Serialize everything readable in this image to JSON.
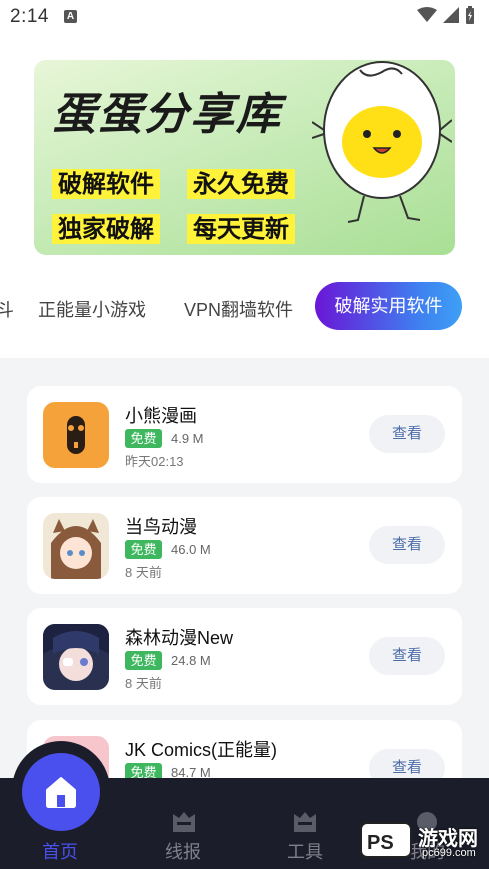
{
  "status_bar": {
    "time": "2:14",
    "notif_letter": "A"
  },
  "banner": {
    "title": "蛋蛋分享库",
    "tags": [
      "破解软件",
      "永久免费",
      "独家破解",
      "每天更新"
    ]
  },
  "tabs": {
    "items": [
      "斗",
      "正能量小游戏",
      "VPN翻墙软件"
    ],
    "active": "破解实用软件"
  },
  "apps": [
    {
      "name": "小熊漫画",
      "badge": "免费",
      "size": "4.9 M",
      "date": "昨天02:13",
      "button": "查看"
    },
    {
      "name": "当鸟动漫",
      "badge": "免费",
      "size": "46.0 M",
      "date": "8 天前",
      "button": "查看"
    },
    {
      "name": "森林动漫New",
      "badge": "免费",
      "size": "24.8 M",
      "date": "8 天前",
      "button": "查看"
    },
    {
      "name": "JK Comics(正能量)",
      "badge": "免费",
      "size": "84.7 M",
      "date": "",
      "button": "查看"
    }
  ],
  "bottom_nav": {
    "items": [
      "首页",
      "线报",
      "工具",
      "我的"
    ],
    "active_index": 0
  },
  "watermark": {
    "text": "游戏网",
    "sub": "pc699.com"
  },
  "colors": {
    "accent": "#4a50ee",
    "badge": "#3eb75f",
    "nav_bg": "#1b1d2a"
  }
}
